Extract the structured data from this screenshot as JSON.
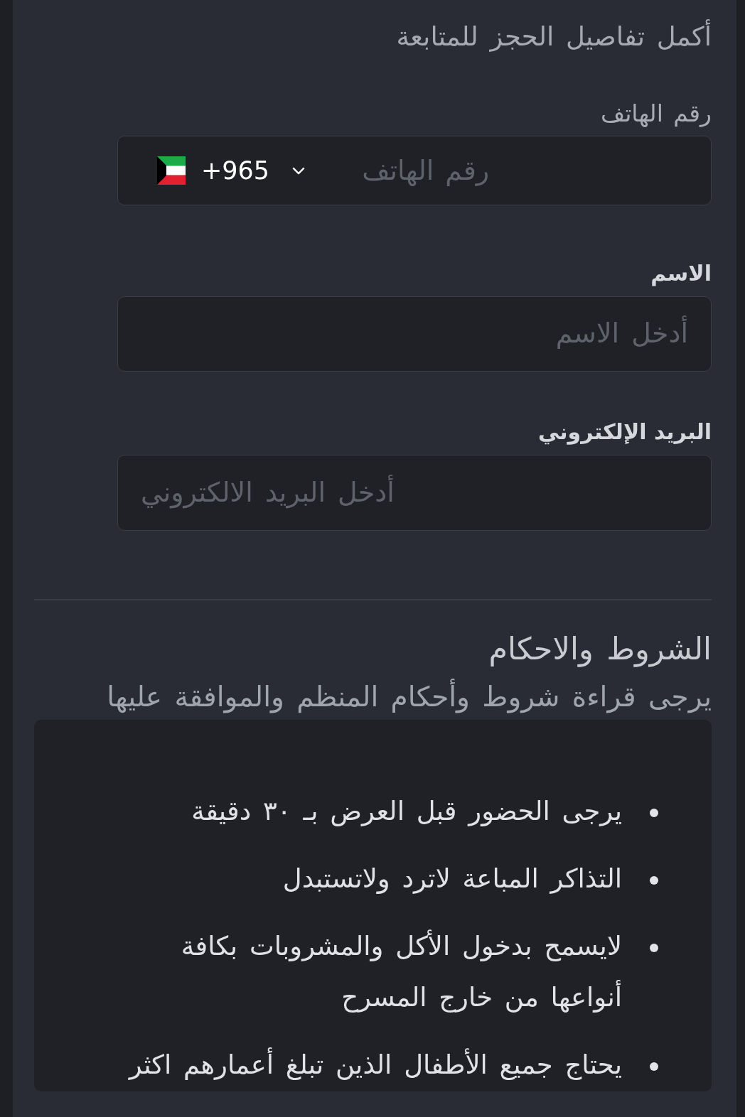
{
  "form": {
    "title": "أكمل تفاصيل الحجز للمتابعة",
    "fields": [
      {
        "kind": "phone",
        "label": "رقم الهاتف",
        "country_code": "+965",
        "placeholder": "رقم الهاتف"
      },
      {
        "kind": "text",
        "label": "الاسم",
        "placeholder": "أدخل الاسم"
      },
      {
        "kind": "email",
        "label": "البريد الإلكتروني",
        "placeholder": "أدخل البريد الالكتروني"
      }
    ]
  },
  "terms": {
    "title": "الشروط والاحكام",
    "subtitle": "يرجى قراءة شروط وأحكام المنظم والموافقة عليها",
    "items": [
      "يرجى الحضور قبل العرض بـ ٣٠ دقيقة",
      "التذاكر المباعة لاترد ولاتستبدل",
      "لايسمح بدخول الأكل والمشروبات بكافة أنواعها من خارج المسرح",
      "يحتاج جميع الأطفال الذين تبلغ أعمارهم اكثر"
    ]
  }
}
